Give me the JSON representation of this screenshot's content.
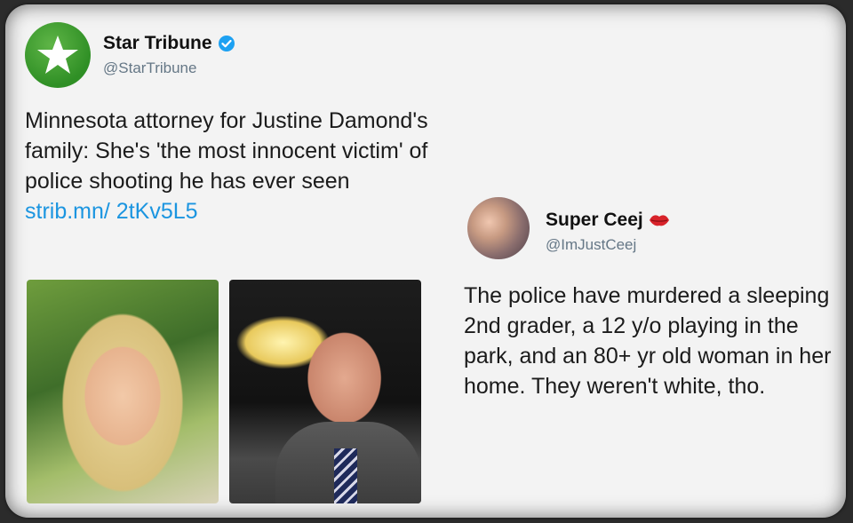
{
  "tweet_left": {
    "name": "Star Tribune",
    "handle": "@StarTribune",
    "text": "Minnesota attorney for Justine Damond's family: She's 'the most innocent victim' of police shooting he has ever seen ",
    "link": "strib.mn/ 2tKv5L5"
  },
  "tweet_right": {
    "name": "Super Ceej",
    "handle": "@ImJustCeej",
    "text": "The police have murdered a sleeping 2nd grader, a 12 y/o playing in the park, and an  80+ yr old woman in her home. They weren't white, tho."
  },
  "colors": {
    "link": "#1b95e0",
    "verified": "#1da1f2",
    "brand_green": "#2f8f25"
  },
  "icons": [
    "star-tribune-logo-icon",
    "verified-badge-icon",
    "lips-emoji-icon"
  ]
}
